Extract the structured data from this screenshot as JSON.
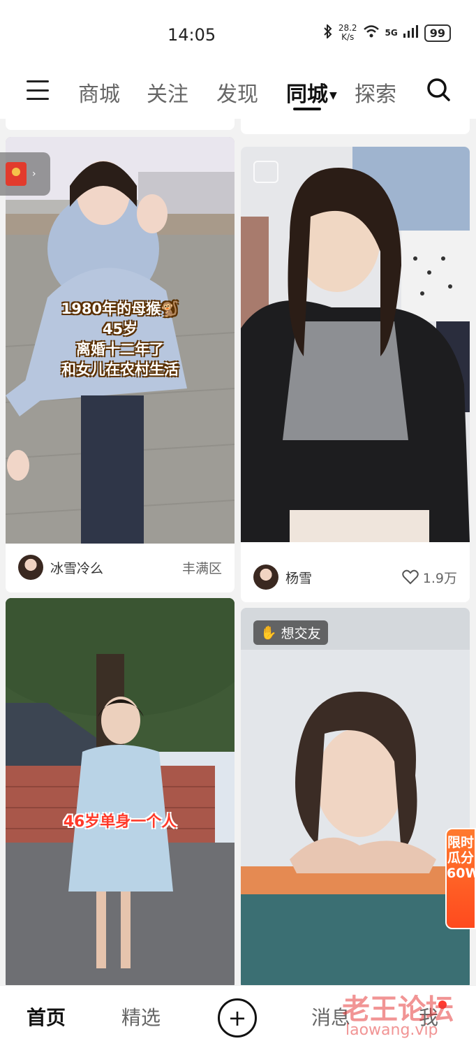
{
  "status": {
    "time": "14:05",
    "speed_value": "28.2",
    "speed_unit": "K/s",
    "network": "5G",
    "battery": "99"
  },
  "nav": {
    "tabs": [
      {
        "label": "商城"
      },
      {
        "label": "关注"
      },
      {
        "label": "发现"
      },
      {
        "label": "同城"
      },
      {
        "label": "探索"
      }
    ]
  },
  "cards": {
    "c1": {
      "overlay_lines": [
        "1980年的母猴🐒",
        "45岁",
        "离婚十二年了",
        "和女儿在农村生活"
      ],
      "name": "冰雪冷么",
      "right": "丰满区"
    },
    "c2": {
      "name": "杨雪",
      "likes": "1.9万"
    },
    "c3": {
      "overlay": "46岁单身一个人"
    },
    "c4": {
      "badge": "想交友"
    }
  },
  "promo": {
    "text": "限时瓜分60W"
  },
  "bottom": {
    "home": "首页",
    "featured": "精选",
    "plus": "+",
    "messages": "消息",
    "me": "我"
  },
  "watermark": {
    "line1": "老王论坛",
    "line2": "laowang.vip"
  }
}
